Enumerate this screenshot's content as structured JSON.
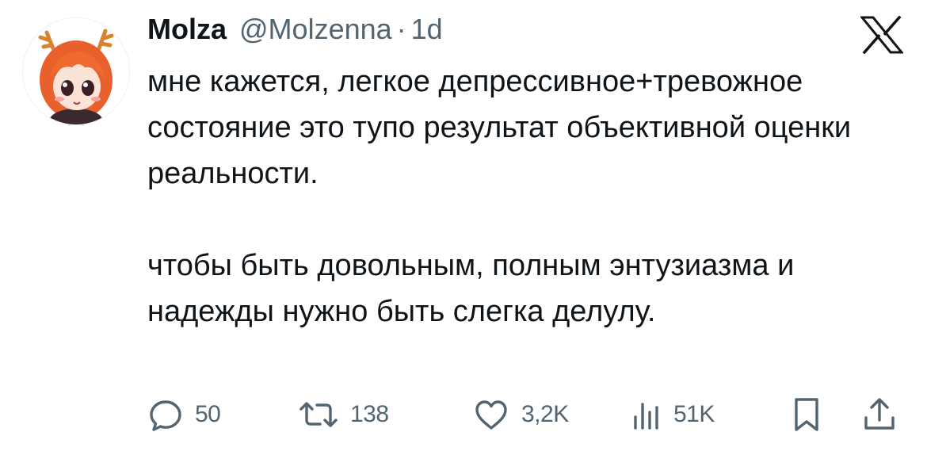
{
  "author": {
    "display_name": "Molza",
    "handle": "@Molzenna",
    "separator": "·",
    "time": "1d"
  },
  "tweet": {
    "paragraphs": [
      "мне кажется, легкое депрессивное+тревожное состояние это тупо результат объективной оценки реальности.",
      "чтобы быть довольным, полным энтузиазма и надежды нужно быть слегка делулу."
    ]
  },
  "actions": {
    "replies": "50",
    "retweets": "138",
    "likes": "3,2K",
    "views": "51K"
  },
  "colors": {
    "text": "#0f1419",
    "secondary": "#536471",
    "background": "#ffffff"
  },
  "icons": [
    "avatar-image",
    "x-logo-icon",
    "reply-icon",
    "retweet-icon",
    "like-icon",
    "views-icon",
    "bookmark-icon",
    "share-icon"
  ]
}
